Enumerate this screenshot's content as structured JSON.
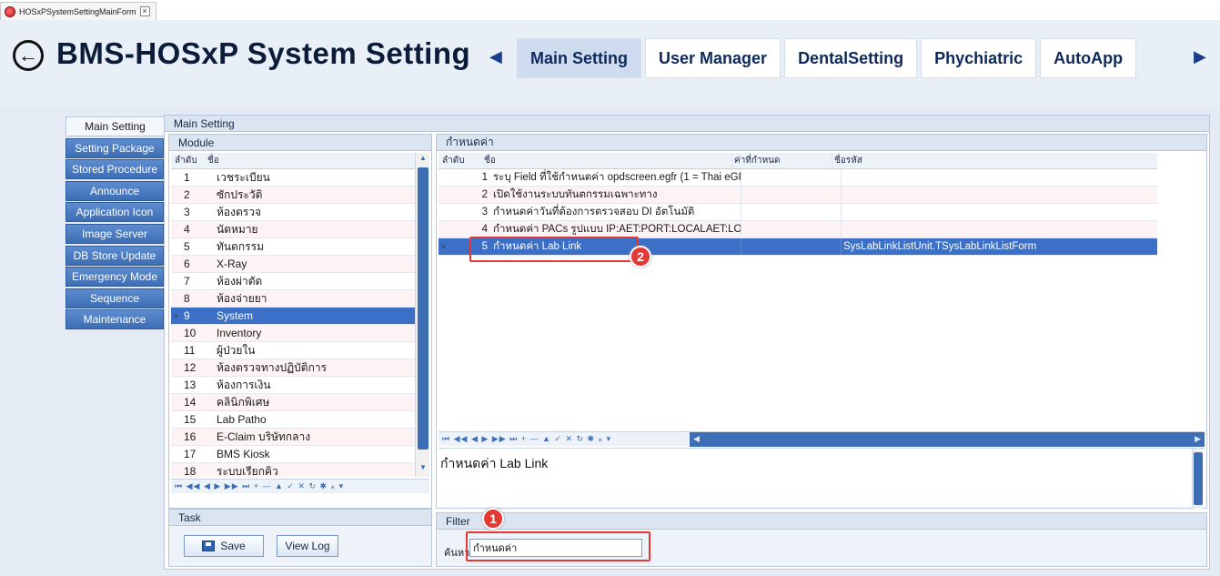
{
  "form_tab": {
    "title": "HOSxPSystemSettingMainForm",
    "close": "×"
  },
  "header": {
    "back_glyph": "←",
    "title": "BMS-HOSxP System Setting",
    "nav_left": "◀",
    "nav_right": "▶",
    "tabs": [
      {
        "label": "Main Setting",
        "active": true
      },
      {
        "label": "User Manager"
      },
      {
        "label": "DentalSetting"
      },
      {
        "label": "Phychiatric"
      },
      {
        "label": "AutoApp"
      }
    ]
  },
  "side_tabs": [
    "Main Setting",
    "Setting Package",
    "Stored Procedure",
    "Announce",
    "Application Icon",
    "Image Server",
    "DB Store Update",
    "Emergency Mode",
    "Sequence",
    "Maintenance"
  ],
  "main_panel": {
    "title": "Main Setting"
  },
  "module": {
    "title": "Module",
    "columns": {
      "no": "ลำดับ",
      "name": "ชื่อ"
    },
    "selected_marker": ">",
    "rows": [
      {
        "no": "1",
        "name": "เวชระเบียน"
      },
      {
        "no": "2",
        "name": "ซักประวัติ"
      },
      {
        "no": "3",
        "name": "ห้องตรวจ"
      },
      {
        "no": "4",
        "name": "นัดหมาย"
      },
      {
        "no": "5",
        "name": "ทันตกรรม"
      },
      {
        "no": "6",
        "name": "X-Ray"
      },
      {
        "no": "7",
        "name": "ห้องผ่าตัด"
      },
      {
        "no": "8",
        "name": "ห้องจ่ายยา"
      },
      {
        "no": "9",
        "name": "System"
      },
      {
        "no": "10",
        "name": "Inventory"
      },
      {
        "no": "11",
        "name": "ผู้ป่วยใน"
      },
      {
        "no": "12",
        "name": "ห้องตรวจทางปฏิบัติการ"
      },
      {
        "no": "13",
        "name": "ห้องการเงิน"
      },
      {
        "no": "14",
        "name": "คลินิกพิเศษ"
      },
      {
        "no": "15",
        "name": "Lab Patho"
      },
      {
        "no": "16",
        "name": "E-Claim บริษัทกลาง"
      },
      {
        "no": "17",
        "name": "BMS Kiosk"
      },
      {
        "no": "18",
        "name": "ระบบเรียกคิว"
      }
    ],
    "selected_index": 8,
    "nav_icons": "⏮ ◀◀ ◀ ▶ ▶▶ ⏭ + — ▲ ✓ ✕ ↻ ✱ ⁎ ▾"
  },
  "task": {
    "title": "Task",
    "save_label": "Save",
    "viewlog_label": "View Log"
  },
  "config": {
    "title": "กำหนดค่า",
    "columns": {
      "no": "ลำดับ",
      "name": "ชื่อ",
      "value": "ค่าที่กำหนด",
      "code": "ชื่อรหัส"
    },
    "selected_marker": ">",
    "rows": [
      {
        "no": "1",
        "name": "ระบุ Field ที่ใช้กำหนดค่า opdscreen.egfr (1 = Thai eGF",
        "value": "",
        "code": ""
      },
      {
        "no": "2",
        "name": "เปิดใช้งานระบบทันตกรรมเฉพาะทาง",
        "value": "",
        "code": ""
      },
      {
        "no": "3",
        "name": "กำหนดค่าวันที่ต้องการตรวจสอบ DI อัตโนมัติ",
        "value": "",
        "code": ""
      },
      {
        "no": "4",
        "name": "กำหนดค่า PACs รูปแบบ IP:AET:PORT:LOCALAET:LO",
        "value": "",
        "code": ""
      },
      {
        "no": "5",
        "name": "กำหนดค่า Lab Link",
        "value": "",
        "code": "SysLabLinkListUnit.TSysLabLinkListForm"
      }
    ],
    "selected_index": 4,
    "nav_icons": "⏮ ◀◀ ◀ ▶ ▶▶ ⏭ + — ▲ ✓ ✕ ↻ ✱ ⁎ ▾",
    "memo_text": "กำหนดค่า Lab Link"
  },
  "filter": {
    "title": "Filter",
    "search_label": "ค้นหา",
    "search_value": "กำหนดค่า"
  },
  "annotations": {
    "badge_1": "1",
    "badge_2": "2",
    "color": "#e53935"
  },
  "colors": {
    "accent": "#3d6db4",
    "selected_row": "#3c70c7",
    "header_bg": "#e9eff7"
  }
}
